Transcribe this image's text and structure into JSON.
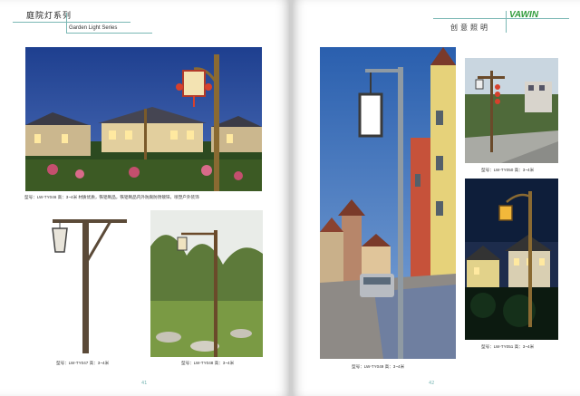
{
  "left_page": {
    "header_cn": "庭院灯系列",
    "header_en": "Garden Light Series",
    "captions": {
      "main": "型号：LW-TY046  高：3~4米  材质优质，铁铝制品，铁铝制品内外防腐防锈镀锌，喷塑户外装饰",
      "bottom_left": "型号：LW-TY047  高：3~4米",
      "bottom_right": "型号：LW-TY048  高：3~4米"
    },
    "page_number": "41"
  },
  "right_page": {
    "brand_cn": "创意照明",
    "logo_text": "VAWIN",
    "captions": {
      "tall": "型号：LW-TY049  高：3~4米",
      "top_right": "型号：LW-TY050  高：3~4米",
      "bottom_right": "型号：LW-TY051  高：3~4米"
    },
    "page_number": "42"
  },
  "colors": {
    "accent_line": "#7ab7b4",
    "logo_green": "#2f9b3a"
  }
}
